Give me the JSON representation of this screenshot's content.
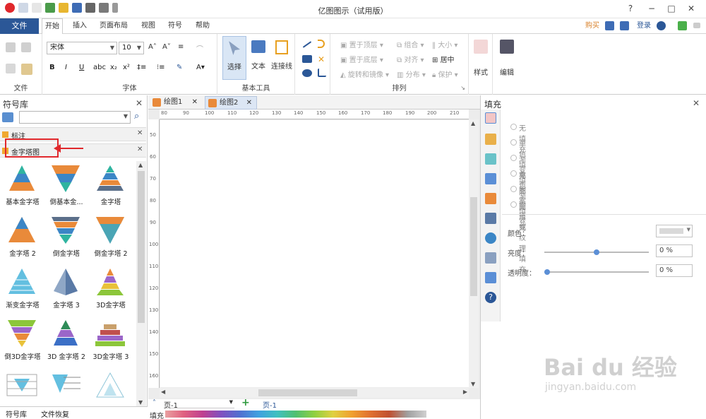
{
  "window": {
    "title": "亿图图示（试用版）"
  },
  "menu": {
    "file": "文件",
    "tabs": [
      "开始",
      "插入",
      "页面布局",
      "视图",
      "符号",
      "帮助"
    ],
    "right": {
      "buy": "购买",
      "login": "登录"
    }
  },
  "ribbon": {
    "font_name": "宋体",
    "font_size": "10",
    "groups": {
      "file": "文件",
      "font": "字体",
      "basic_tools": "基本工具",
      "arrange": "排列"
    },
    "tools": {
      "select": "选择",
      "text": "文本",
      "connector": "连接线"
    },
    "arrange": {
      "bring_top": "置于顶层",
      "send_bottom": "置于底层",
      "rotate": "旋转和镜像",
      "group": "组合",
      "align": "对齐",
      "distribute": "分布",
      "size": "大小",
      "center": "居中",
      "protect": "保护"
    },
    "style": "样式",
    "edit": "编辑"
  },
  "symbol_library": {
    "title": "符号库",
    "categories": [
      {
        "label": "标注"
      },
      {
        "label": "金字塔图"
      }
    ],
    "shapes": [
      {
        "label": "基本金字塔"
      },
      {
        "label": "倒基本金..."
      },
      {
        "label": "金字塔"
      },
      {
        "label": "金字塔 2"
      },
      {
        "label": "倒金字塔"
      },
      {
        "label": "倒金字塔 2"
      },
      {
        "label": "渐变金字塔"
      },
      {
        "label": "金字塔 3"
      },
      {
        "label": "3D金字塔"
      },
      {
        "label": "倒3D金字塔"
      },
      {
        "label": "3D 金字塔 2"
      },
      {
        "label": "3D金字塔 3"
      }
    ],
    "bottom_tabs": [
      "符号库",
      "文件恢复"
    ]
  },
  "documents": {
    "tabs": [
      "绘图1",
      "绘图2"
    ],
    "active": 1
  },
  "rulers": {
    "h": [
      "80",
      "90",
      "100",
      "110",
      "120",
      "130",
      "140",
      "150",
      "160",
      "170",
      "180",
      "190",
      "200",
      "210"
    ],
    "v": [
      "50",
      "60",
      "70",
      "80",
      "90",
      "100",
      "110",
      "120",
      "130",
      "140",
      "150",
      "160"
    ]
  },
  "pages": {
    "current": "页-1",
    "tab": "页-1",
    "fill_label": "填充"
  },
  "fill_panel": {
    "title": "填充",
    "options": [
      "无填充",
      "单色填充",
      "渐变填充",
      "单色渐变填充",
      "图案填充",
      "图片或纹理填充"
    ],
    "color_label": "颜色：",
    "brightness_label": "亮度：",
    "brightness_value": "0 %",
    "brightness_fraction": 0.5,
    "transparency_label": "透明度：",
    "transparency_value": "0 %",
    "transparency_fraction": 0.0
  },
  "watermark": {
    "brand": "Bai du 经验",
    "url": "jingyan.baidu.com"
  },
  "colors": {
    "accent": "#2b5797",
    "highlight": "#e0282c"
  }
}
